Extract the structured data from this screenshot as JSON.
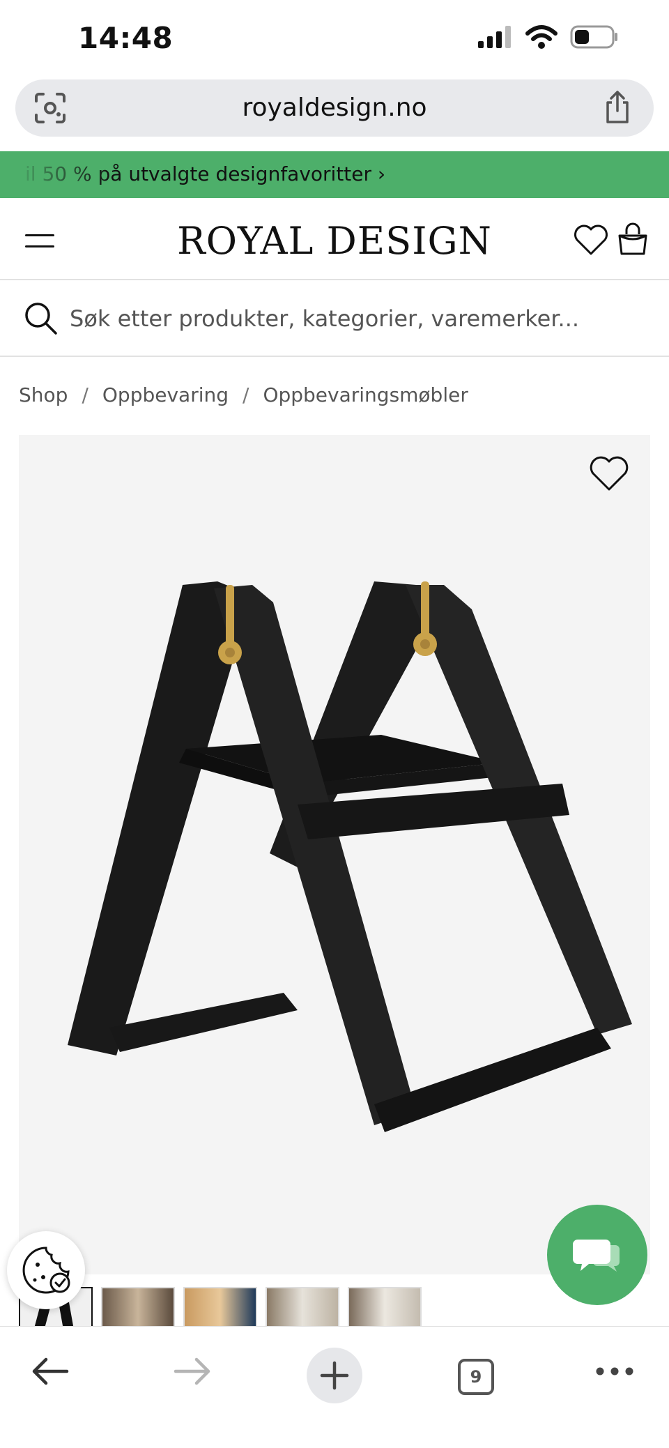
{
  "status_bar": {
    "time": "14:48"
  },
  "browser": {
    "url": "royaldesign.no",
    "tab_count": "9"
  },
  "promo": {
    "text": "il 50 % på utvalgte designfavoritter ›"
  },
  "header": {
    "logo": "ROYAL DESIGN"
  },
  "search": {
    "placeholder": "Søk etter produkter, kategorier, varemerker..."
  },
  "breadcrumb": {
    "items": [
      "Shop",
      "Oppbevaring",
      "Oppbevaringsmøbler"
    ],
    "separator": "/"
  },
  "colors": {
    "accent_green": "#4daf6a",
    "product_bg": "#f4f4f4",
    "brass": "#c9a24a"
  },
  "icons": [
    "camera-scan-icon",
    "share-icon",
    "menu-icon",
    "heart-icon",
    "bag-icon",
    "search-icon",
    "cookie-icon",
    "chat-icon",
    "back-arrow-icon",
    "forward-arrow-icon",
    "plus-icon",
    "more-icon"
  ]
}
